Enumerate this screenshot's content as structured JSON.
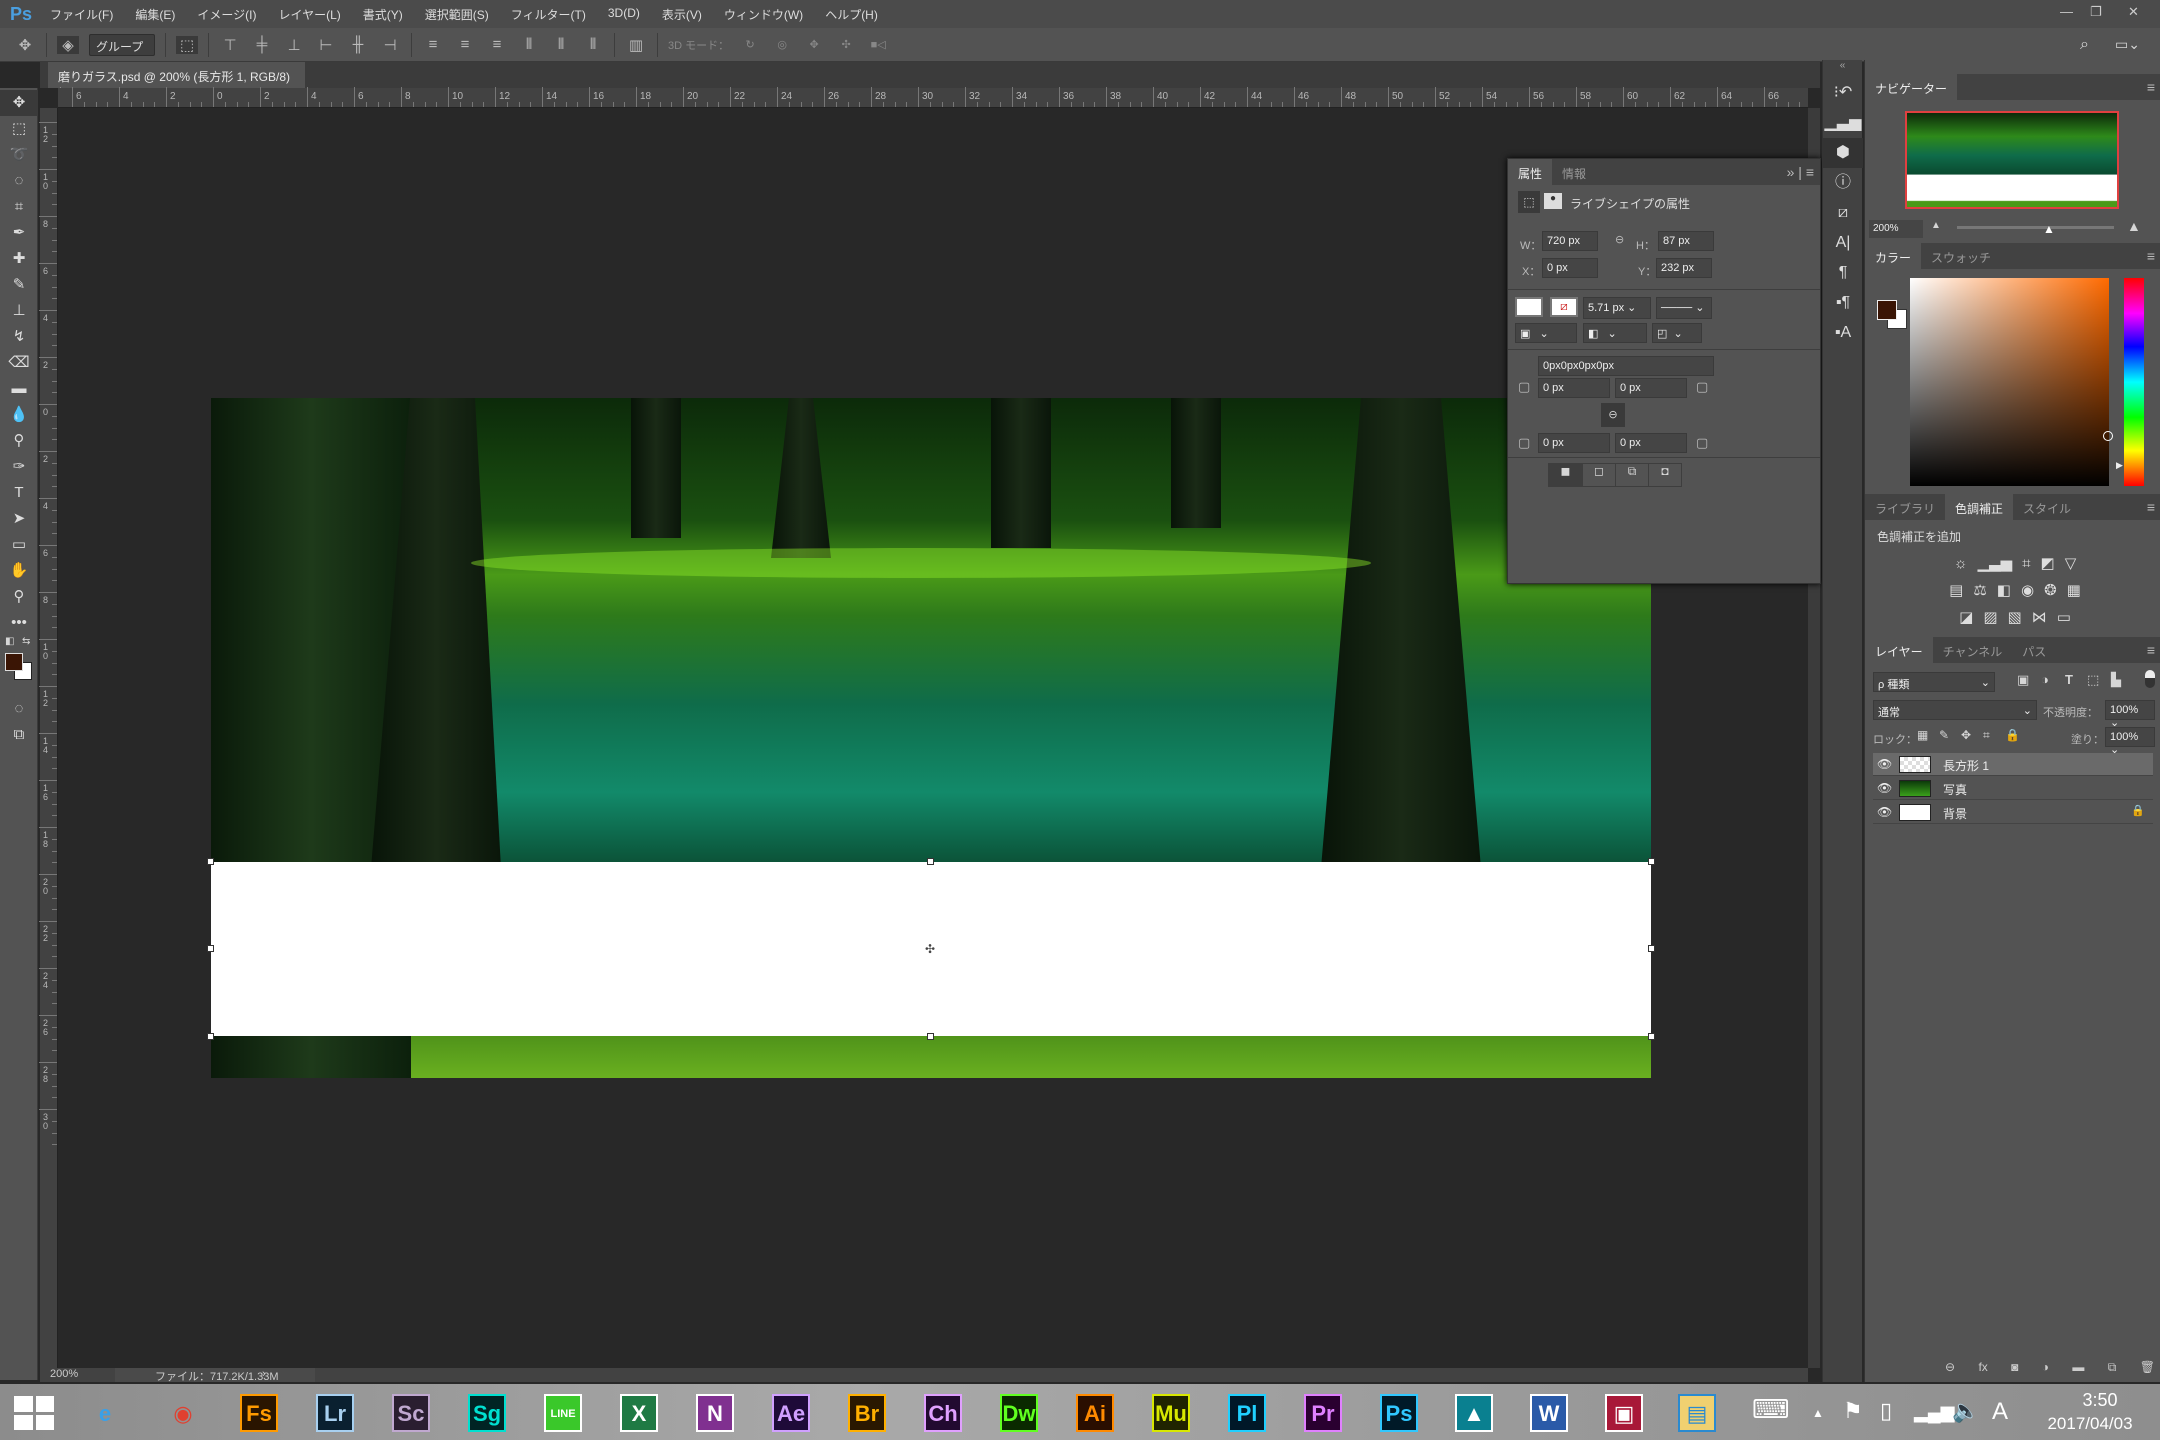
{
  "app": {
    "logo": "Ps",
    "menu": [
      "ファイル(F)",
      "編集(E)",
      "イメージ(I)",
      "レイヤー(L)",
      "書式(Y)",
      "選択範囲(S)",
      "フィルター(T)",
      "3D(D)",
      "表示(V)",
      "ウィンドウ(W)",
      "ヘルプ(H)"
    ]
  },
  "options": {
    "auto_select": "グループ",
    "mode_3d": "3D モード："
  },
  "document": {
    "tab_title": "磨りガラス.psd @ 200% (長方形 1, RGB/8) *",
    "close": "×"
  },
  "rulers": {
    "top": [
      "6",
      "4",
      "2",
      "0",
      "2",
      "4",
      "6",
      "8",
      "10",
      "12",
      "14",
      "16",
      "18",
      "20",
      "22",
      "24",
      "26",
      "28",
      "30",
      "32",
      "34",
      "36",
      "38",
      "40",
      "42",
      "44",
      "46",
      "48",
      "50",
      "52",
      "54",
      "56",
      "58",
      "60",
      "62",
      "64",
      "66"
    ],
    "left": [
      "12",
      "10",
      "8",
      "6",
      "4",
      "2",
      "0",
      "2",
      "4",
      "6",
      "8",
      "10",
      "12",
      "14",
      "16",
      "18",
      "20",
      "22",
      "24",
      "26",
      "28",
      "30"
    ]
  },
  "status": {
    "zoom": "200%",
    "file": "ファイル：717.2K/1.33M",
    "arrow": "›"
  },
  "tools": [
    [
      "move-tool",
      "✥"
    ],
    [
      "marquee-tool",
      "⬚"
    ],
    [
      "lasso-tool",
      "➰"
    ],
    [
      "quick-select-tool",
      "◌"
    ],
    [
      "crop-tool",
      "⌗"
    ],
    [
      "eyedropper-tool",
      "✒"
    ],
    [
      "healing-tool",
      "✚"
    ],
    [
      "brush-tool",
      "✎"
    ],
    [
      "stamp-tool",
      "⊥"
    ],
    [
      "history-brush-tool",
      "↯"
    ],
    [
      "eraser-tool",
      "⌫"
    ],
    [
      "gradient-tool",
      "▬"
    ],
    [
      "blur-tool",
      "💧"
    ],
    [
      "dodge-tool",
      "⚲"
    ],
    [
      "pen-tool",
      "✑"
    ],
    [
      "type-tool",
      "T"
    ],
    [
      "path-select-tool",
      "➤"
    ],
    [
      "rectangle-tool",
      "▭"
    ],
    [
      "hand-tool",
      "✋"
    ],
    [
      "zoom-tool",
      "⚲"
    ],
    [
      "more-tools",
      "•••"
    ]
  ],
  "colors": {
    "foreground": "#3a1505",
    "background": "#ffffff",
    "accent": "#4a9fe0",
    "selection_red": "#e04040"
  },
  "properties": {
    "tabs": [
      "属性",
      "情報"
    ],
    "header": "ライブシェイプの属性",
    "w_label": "W：",
    "w": "720 px",
    "h_label": "H：",
    "h": "87 px",
    "x_label": "X：",
    "x": "0 px",
    "y_label": "Y：",
    "y": "232 px",
    "stroke_width": "5.71 px",
    "radius_all": "0px0px0px0px",
    "radius": [
      "0 px",
      "0 px",
      "0 px",
      "0 px"
    ]
  },
  "navigator": {
    "tab": "ナビゲーター",
    "zoom": "200%",
    "slider_value": 0.58
  },
  "color_panel": {
    "tabs": [
      "カラー",
      "スウォッチ"
    ]
  },
  "adjustments": {
    "tabs": [
      "ライブラリ",
      "色調補正",
      "スタイル"
    ],
    "add_label": "色調補正を追加"
  },
  "layers": {
    "tabs": [
      "レイヤー",
      "チャンネル",
      "パス"
    ],
    "filter": "ρ 種類",
    "blend": "通常",
    "opacity_label": "不透明度：",
    "opacity": "100%",
    "lock_label": "ロック：",
    "fill_label": "塗り：",
    "fill": "100%",
    "items": [
      {
        "name": "長方形 1",
        "selected": true
      },
      {
        "name": "写真",
        "selected": false
      },
      {
        "name": "背景",
        "selected": false,
        "locked": true
      }
    ]
  },
  "taskbar": {
    "apps": [
      [
        "internet-explorer",
        "e",
        "#3aa0e8",
        "transparent"
      ],
      [
        "chrome",
        "◉",
        "#e04030",
        "transparent"
      ],
      [
        "fuse",
        "Fs",
        "#ff9a00",
        "#2a1500"
      ],
      [
        "lightroom",
        "Lr",
        "#a8d0f0",
        "#0a2030"
      ],
      [
        "scout",
        "Sc",
        "#c0a8d0",
        "#2a1e30"
      ],
      [
        "speedgrade",
        "Sg",
        "#00e0d0",
        "#002424"
      ],
      [
        "line",
        "LINE",
        "#fff",
        "#3ac82a"
      ],
      [
        "excel",
        "X",
        "#fff",
        "#1f7a44"
      ],
      [
        "onenote",
        "N",
        "#fff",
        "#803090"
      ],
      [
        "after-effects",
        "Ae",
        "#d0a0ff",
        "#1e0a38"
      ],
      [
        "bridge",
        "Br",
        "#ffb000",
        "#2a1800"
      ],
      [
        "character-animator",
        "Ch",
        "#e0a0ff",
        "#220a30"
      ],
      [
        "dreamweaver",
        "Dw",
        "#60ff20",
        "#0a2a00"
      ],
      [
        "illustrator",
        "Ai",
        "#ff8a00",
        "#2a0e00"
      ],
      [
        "muse",
        "Mu",
        "#d8e800",
        "#202400"
      ],
      [
        "prelude",
        "Pl",
        "#20d0ff",
        "#001828"
      ],
      [
        "premiere",
        "Pr",
        "#e080ff",
        "#2a0030"
      ],
      [
        "photoshop",
        "Ps",
        "#30c8ff",
        "#001a28"
      ],
      [
        "photos",
        "▲",
        "#fff",
        "#0a8090"
      ],
      [
        "word",
        "W",
        "#fff",
        "#2a5aa8"
      ],
      [
        "red-app",
        "▣",
        "#fff",
        "#a81838"
      ],
      [
        "file-explorer",
        "▤",
        "#2a8ad0",
        "#f0d070"
      ]
    ],
    "clock_time": "3:50",
    "clock_date": "2017/04/03",
    "ime": "A"
  }
}
